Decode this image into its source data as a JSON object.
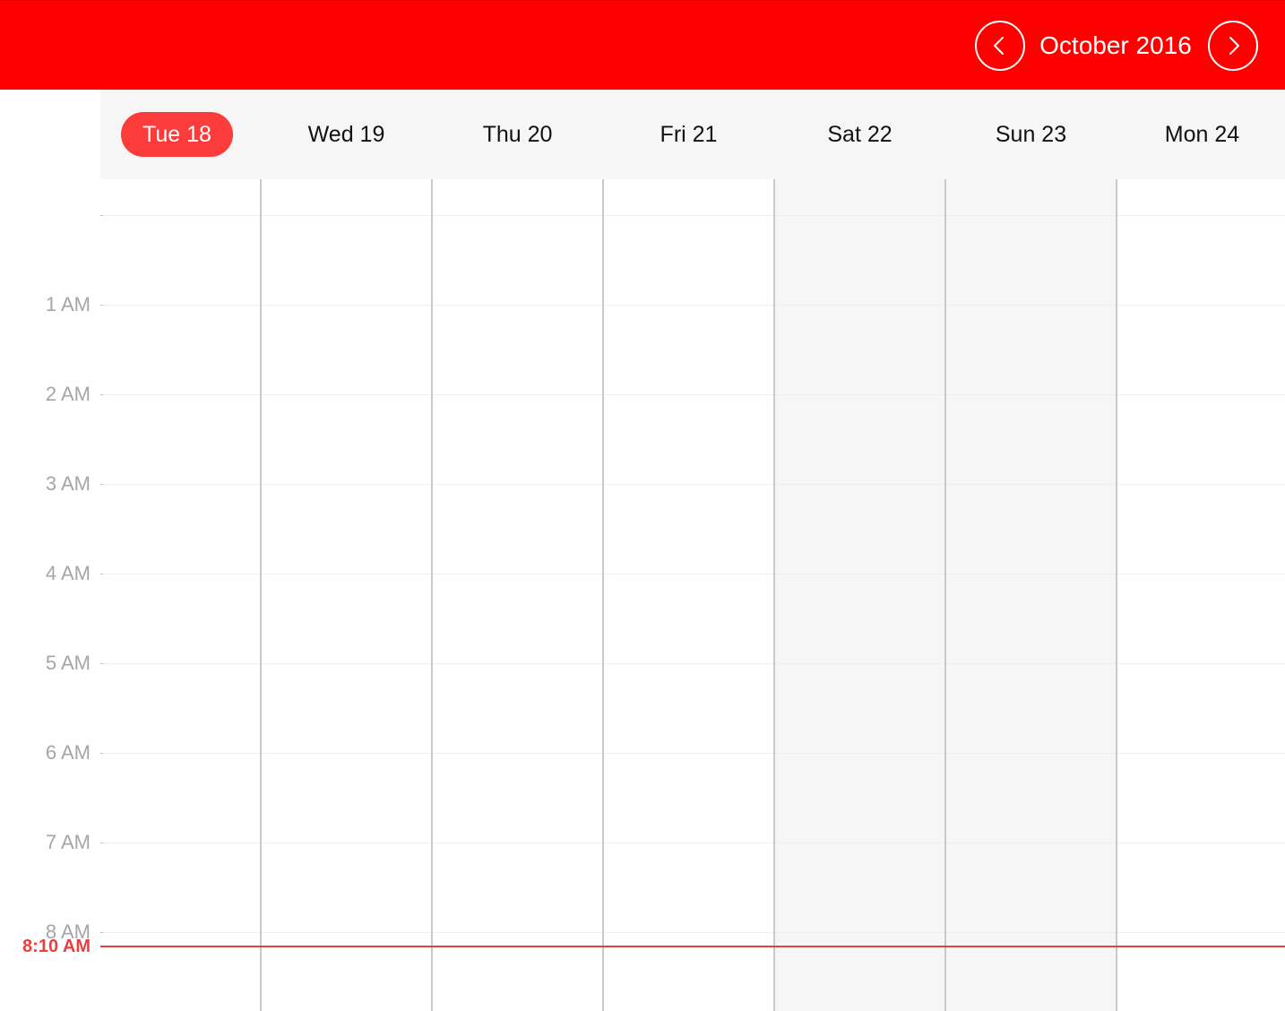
{
  "header": {
    "title": "October 2016",
    "prev_icon": "chevron-left-icon",
    "next_icon": "chevron-right-icon",
    "accent_color": "#ff0000"
  },
  "days": [
    {
      "label": "Tue 18",
      "today": true,
      "weekend": false
    },
    {
      "label": "Wed 19",
      "today": false,
      "weekend": false
    },
    {
      "label": "Thu 20",
      "today": false,
      "weekend": false
    },
    {
      "label": "Fri 21",
      "today": false,
      "weekend": false
    },
    {
      "label": "Sat 22",
      "today": false,
      "weekend": true
    },
    {
      "label": "Sun 23",
      "today": false,
      "weekend": true
    },
    {
      "label": "Mon 24",
      "today": false,
      "weekend": false
    }
  ],
  "hours": [
    "",
    "1 AM",
    "2 AM",
    "3 AM",
    "4 AM",
    "5 AM",
    "6 AM",
    "7 AM",
    "8 AM"
  ],
  "current_time": {
    "label": "8:10 AM",
    "hour_fraction": 8.1667,
    "color": "#e8403f"
  },
  "today_color": "#fc3b3b"
}
